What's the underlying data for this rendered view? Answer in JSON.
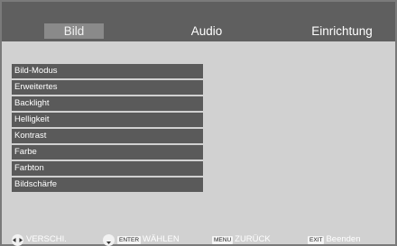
{
  "tabs": [
    {
      "label": "Bild",
      "selected": true
    },
    {
      "label": "Audio",
      "selected": false
    },
    {
      "label": "Einrichtung",
      "selected": false
    }
  ],
  "menu_items": [
    "Bild-Modus",
    "Erweitertes",
    "Backlight",
    "Helligkeit",
    "Kontrast",
    "Farbe",
    "Farbton",
    "Bildschärfe"
  ],
  "hints": {
    "move": {
      "label": "VERSCHI."
    },
    "select": {
      "key": "ENTER",
      "label": "WÄHLEN"
    },
    "back": {
      "key": "MENU",
      "label": "ZURÜCK"
    },
    "exit": {
      "key": "EXIT",
      "label": "Beenden"
    }
  },
  "colors": {
    "topbar": "#5f5f5f",
    "selected_tab": "#8a8a8a",
    "panel": "#d1d1d1",
    "menu_item": "#5a5a5a"
  }
}
